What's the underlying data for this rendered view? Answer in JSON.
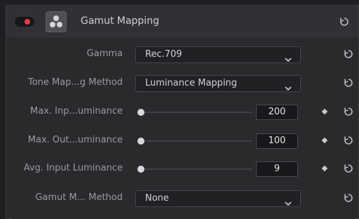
{
  "header": {
    "title": "Gamut Mapping",
    "toggle_enabled": true,
    "accent_color": "#e0403f"
  },
  "rows": [
    {
      "label": "Gamma",
      "type": "dropdown",
      "value": "Rec.709"
    },
    {
      "label": "Tone Map...g Method",
      "type": "dropdown",
      "value": "Luminance Mapping"
    },
    {
      "label": "Max. Inp...uminance",
      "type": "slider",
      "value": "200"
    },
    {
      "label": "Max. Out...uminance",
      "type": "slider",
      "value": "100"
    },
    {
      "label": "Avg. Input Luminance",
      "type": "slider",
      "value": "9"
    },
    {
      "label": "Gamut M... Method",
      "type": "dropdown",
      "value": "None"
    }
  ],
  "icons": {
    "fx": "davinci-resolve-icon",
    "reset": "reset-icon",
    "keyframe": "keyframe-diamond-icon",
    "dropdown": "chevron-down-icon"
  }
}
